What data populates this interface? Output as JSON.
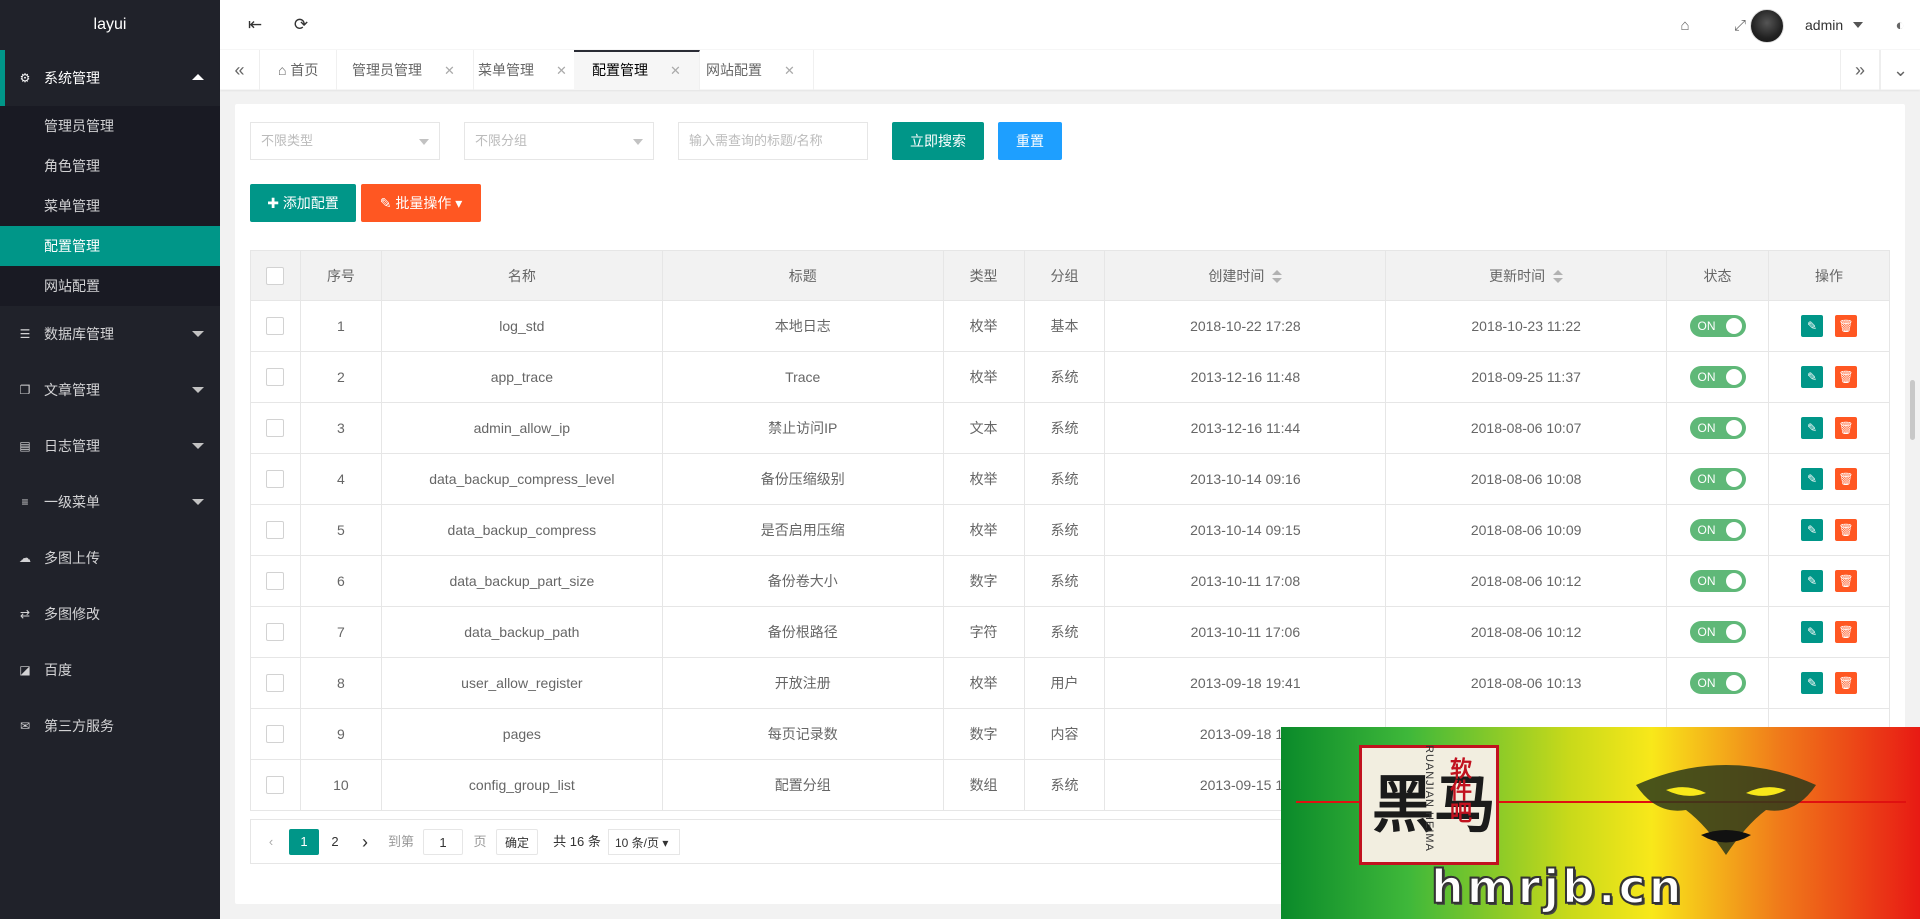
{
  "app": {
    "logo": "layui"
  },
  "sidebar": {
    "system": {
      "label": "系统管理",
      "children": [
        "管理员管理",
        "角色管理",
        "菜单管理",
        "配置管理",
        "网站配置"
      ],
      "active_index": 3
    },
    "items": [
      {
        "label": "数据库管理",
        "icon": "database-icon",
        "has_children": true
      },
      {
        "label": "文章管理",
        "icon": "copy-icon",
        "has_children": true
      },
      {
        "label": "日志管理",
        "icon": "list-icon",
        "has_children": true
      },
      {
        "label": "一级菜单",
        "icon": "menu-icon",
        "has_children": true
      },
      {
        "label": "多图上传",
        "icon": "cloud-upload-icon",
        "has_children": false
      },
      {
        "label": "多图修改",
        "icon": "exchange-icon",
        "has_children": false
      },
      {
        "label": "百度",
        "icon": "external-link-icon",
        "has_children": false
      },
      {
        "label": "第三方服务",
        "icon": "envelope-icon",
        "has_children": false
      }
    ]
  },
  "header": {
    "user": "admin"
  },
  "tabs": [
    {
      "label": "首页",
      "closable": false,
      "icon": "home-icon"
    },
    {
      "label": "管理员管理",
      "closable": true
    },
    {
      "label": "菜单管理",
      "closable": true
    },
    {
      "label": "配置管理",
      "closable": true,
      "active": true
    },
    {
      "label": "网站配置",
      "closable": true
    }
  ],
  "toolbar": {
    "type_placeholder": "不限类型",
    "group_placeholder": "不限分组",
    "search_placeholder": "输入需查询的标题/名称",
    "search_label": "立即搜索",
    "reset_label": "重置",
    "add_label": "添加配置",
    "batch_label": "批量操作"
  },
  "table": {
    "headers": [
      "序号",
      "名称",
      "标题",
      "类型",
      "分组",
      "创建时间",
      "更新时间",
      "状态",
      "操作"
    ],
    "switch_on": "ON",
    "rows": [
      {
        "no": "1",
        "name": "log_std",
        "title": "本地日志",
        "type": "枚举",
        "group": "基本",
        "created": "2018-10-22 17:28",
        "updated": "2018-10-23 11:22"
      },
      {
        "no": "2",
        "name": "app_trace",
        "title": "Trace",
        "type": "枚举",
        "group": "系统",
        "created": "2013-12-16 11:48",
        "updated": "2018-09-25 11:37"
      },
      {
        "no": "3",
        "name": "admin_allow_ip",
        "title": "禁止访问IP",
        "type": "文本",
        "group": "系统",
        "created": "2013-12-16 11:44",
        "updated": "2018-08-06 10:07"
      },
      {
        "no": "4",
        "name": "data_backup_compress_level",
        "title": "备份压缩级别",
        "type": "枚举",
        "group": "系统",
        "created": "2013-10-14 09:16",
        "updated": "2018-08-06 10:08"
      },
      {
        "no": "5",
        "name": "data_backup_compress",
        "title": "是否启用压缩",
        "type": "枚举",
        "group": "系统",
        "created": "2013-10-14 09:15",
        "updated": "2018-08-06 10:09"
      },
      {
        "no": "6",
        "name": "data_backup_part_size",
        "title": "备份卷大小",
        "type": "数字",
        "group": "系统",
        "created": "2013-10-11 17:08",
        "updated": "2018-08-06 10:12"
      },
      {
        "no": "7",
        "name": "data_backup_path",
        "title": "备份根路径",
        "type": "字符",
        "group": "系统",
        "created": "2013-10-11 17:06",
        "updated": "2018-08-06 10:12"
      },
      {
        "no": "8",
        "name": "user_allow_register",
        "title": "开放注册",
        "type": "枚举",
        "group": "用户",
        "created": "2013-09-18 19:41",
        "updated": "2018-08-06 10:13"
      },
      {
        "no": "9",
        "name": "pages",
        "title": "每页记录数",
        "type": "数字",
        "group": "内容",
        "created": "2013-09-18 19",
        "updated": ""
      },
      {
        "no": "10",
        "name": "config_group_list",
        "title": "配置分组",
        "type": "数组",
        "group": "系统",
        "created": "2013-09-15 14",
        "updated": ""
      }
    ]
  },
  "pager": {
    "current": "1",
    "next": "2",
    "goto_label": "到第",
    "page_value": "1",
    "page_unit": "页",
    "confirm": "确定",
    "total": "共 16 条",
    "per_page": "10 条/页"
  },
  "ad": {
    "logo_char": "黑马",
    "side_text": "软件吧",
    "en_text": "RUANJIAN HEIMA",
    "url": "hmrjb.cn"
  }
}
